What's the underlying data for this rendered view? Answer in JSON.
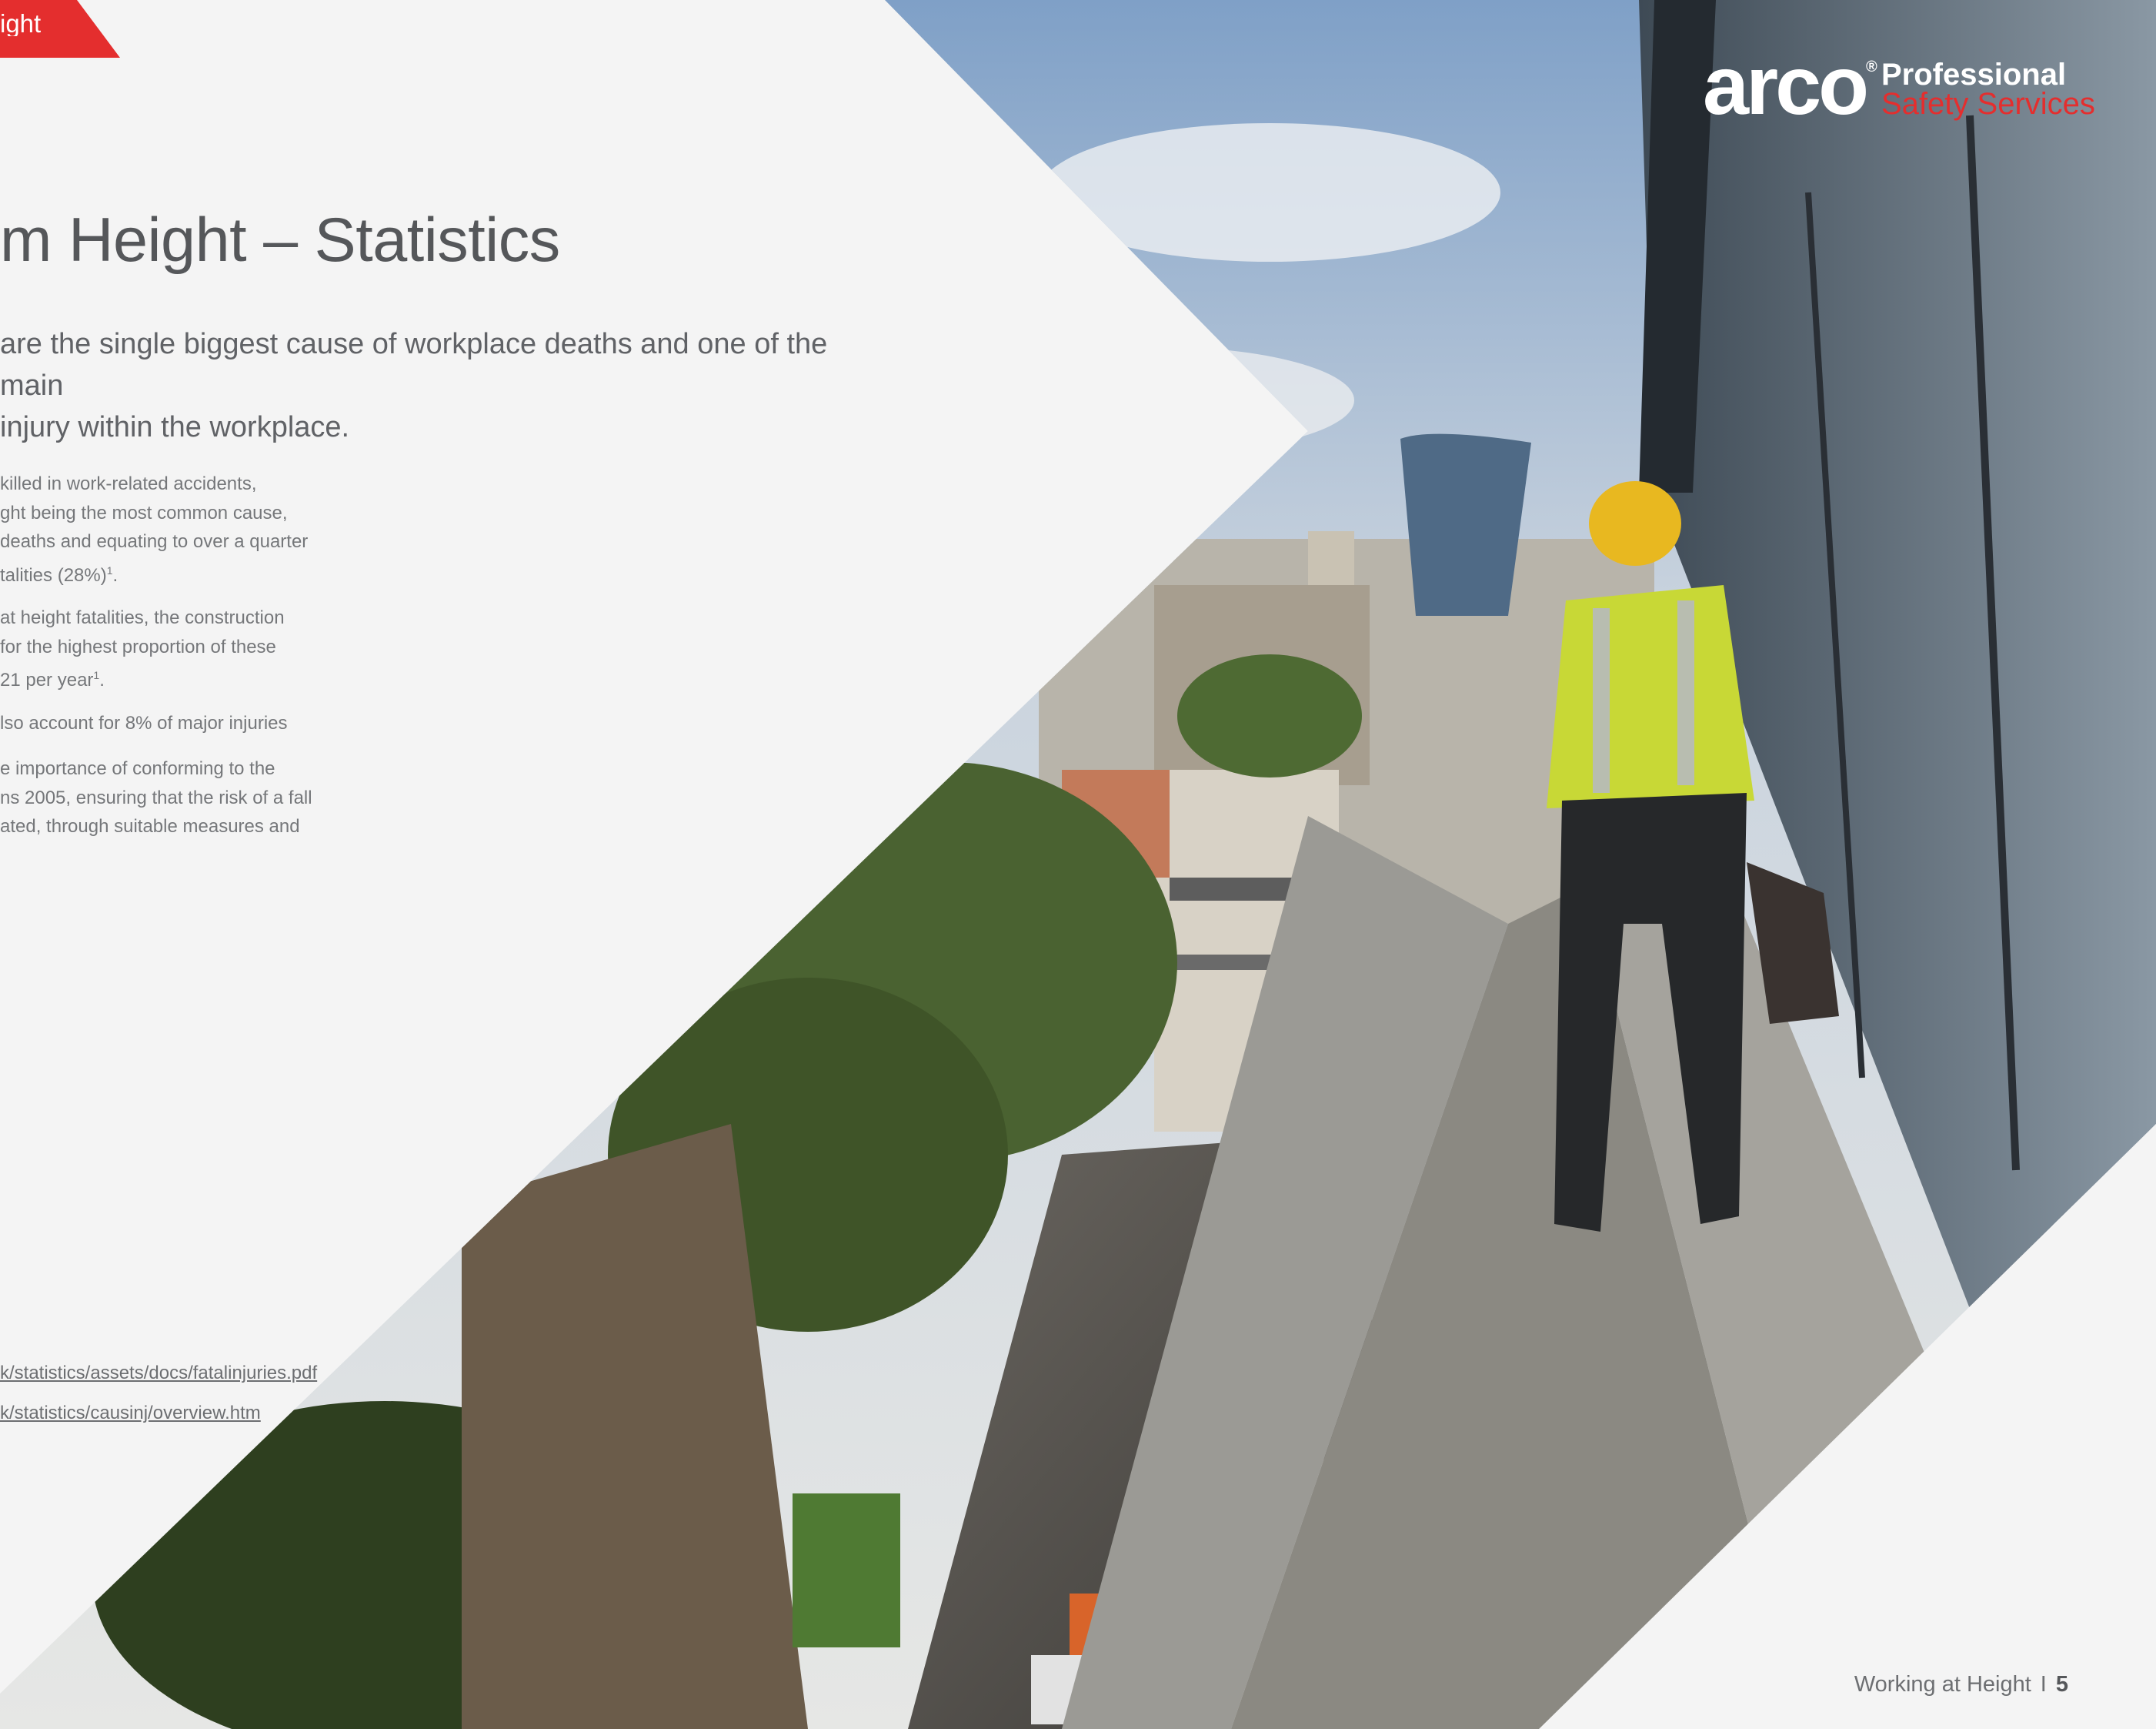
{
  "header": {
    "section_tab": "ight"
  },
  "main": {
    "title": "m Height – Statistics",
    "intro": "are the single biggest cause of workplace deaths and one of the main\ninjury within the workplace.",
    "bullets": [
      "killed in work-related accidents,\nght being the most common cause,\ndeaths and equating to over a quarter\ntalities (28%)",
      "at height fatalities, the construction\nfor the highest proportion of these\n21 per year",
      "lso account for 8% of major injuries",
      "e importance of conforming to the\nns 2005, ensuring that the risk of a fall\nated, through suitable measures and"
    ],
    "footnote_marker": "1",
    "references": [
      "k/statistics/assets/docs/fatalinjuries.pdf",
      "k/statistics/causinj/overview.htm"
    ]
  },
  "logo": {
    "word": "arco",
    "registered": "®",
    "line1": "Professional",
    "line2": "Safety Services",
    "accent_color": "#e42e2e"
  },
  "footer": {
    "label": "Working at Height",
    "separator": "I",
    "page_number": "5"
  }
}
